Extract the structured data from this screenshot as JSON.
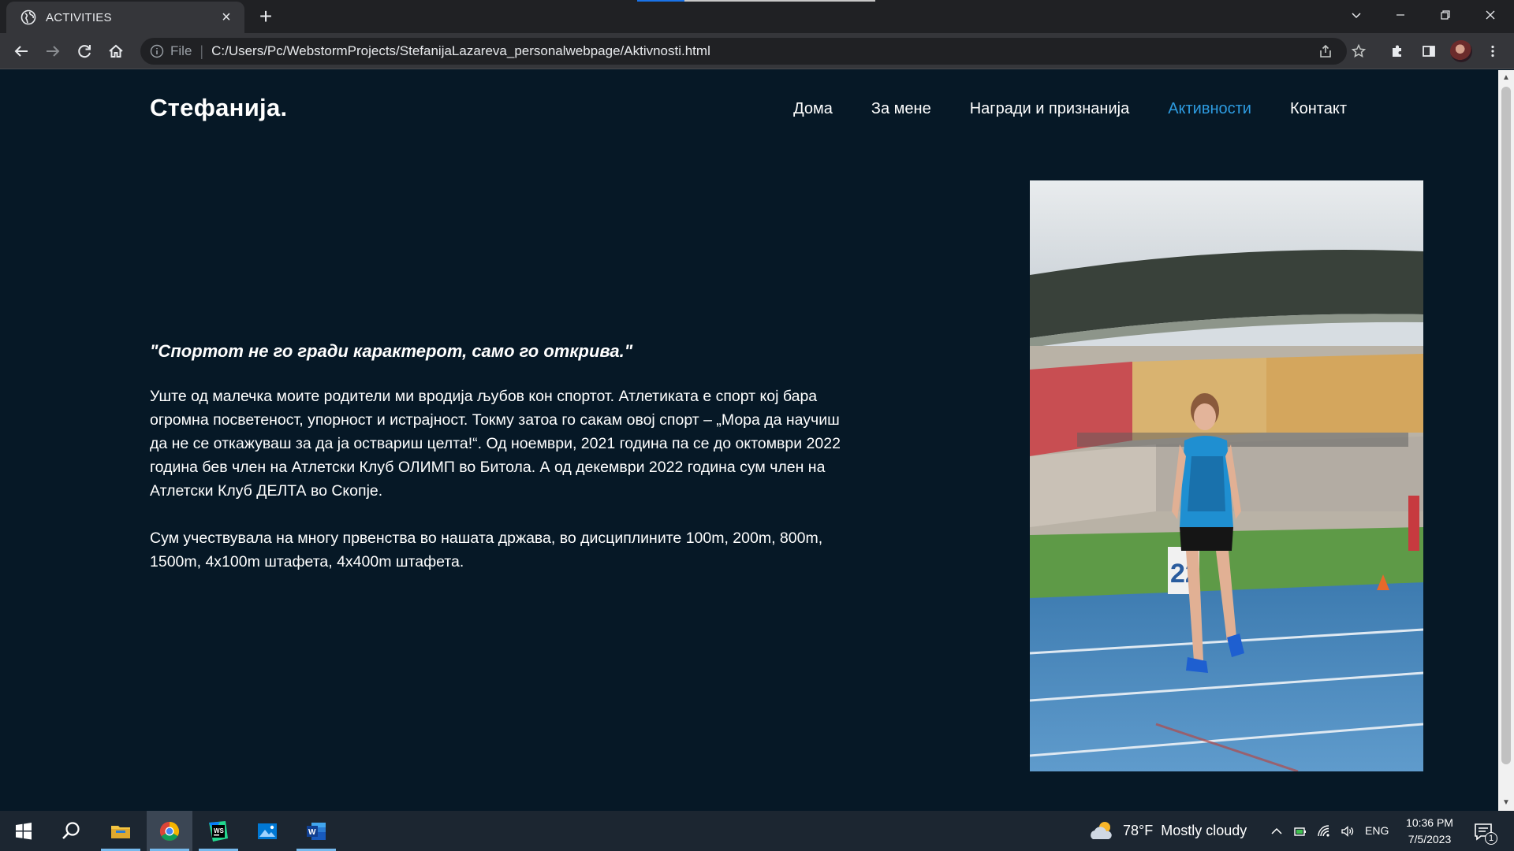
{
  "browser": {
    "tab_title": "ACTIVITIES",
    "address_scheme": "File",
    "address_url": "C:/Users/Pc/WebstormProjects/StefanijaLazareva_personalwebpage/Aktivnosti.html"
  },
  "site": {
    "brand": "Стефанија.",
    "nav": [
      {
        "label": "Дома",
        "active": false
      },
      {
        "label": "За мене",
        "active": false
      },
      {
        "label": "Награди и признанија",
        "active": false
      },
      {
        "label": "Активности",
        "active": true
      },
      {
        "label": "Контакт",
        "active": false
      }
    ],
    "quote": "\"Спортот не го гради карактерот, само го открива.\"",
    "paragraph_1": "Уште од малечка моите родители ми вродија љубов кон спортот. Атлетиката е спорт кој бара огромна посветеност, упорност и истрајност. Токму затоа го сакам овој спорт – „Мора да научиш да не се откажуваш за да ја оствариш целта!“. Од ноември, 2021 година па се до октомври 2022 година бев член на Атлетски Клуб ОЛИМП во Битола. А од декември 2022 година сум член на Атлетски Клуб ДЕЛТА во Скопје.",
    "paragraph_2": "Сум учествувала на многу првенства во нашата држава, во дисциплините 100m, 200m, 800m, 1500m, 4x100m штафета, 4x400m штафета.",
    "photo_bib_number": "22"
  },
  "taskbar": {
    "weather_temp": "78°F",
    "weather_text": "Mostly cloudy",
    "language": "ENG",
    "time": "10:36 PM",
    "date": "7/5/2023",
    "notification_count": "1"
  },
  "colors": {
    "page_bg": "#061826",
    "nav_active": "#2d9be0",
    "chrome_dark": "#202124",
    "chrome_tab": "#35363a",
    "taskbar": "#1c2631"
  }
}
